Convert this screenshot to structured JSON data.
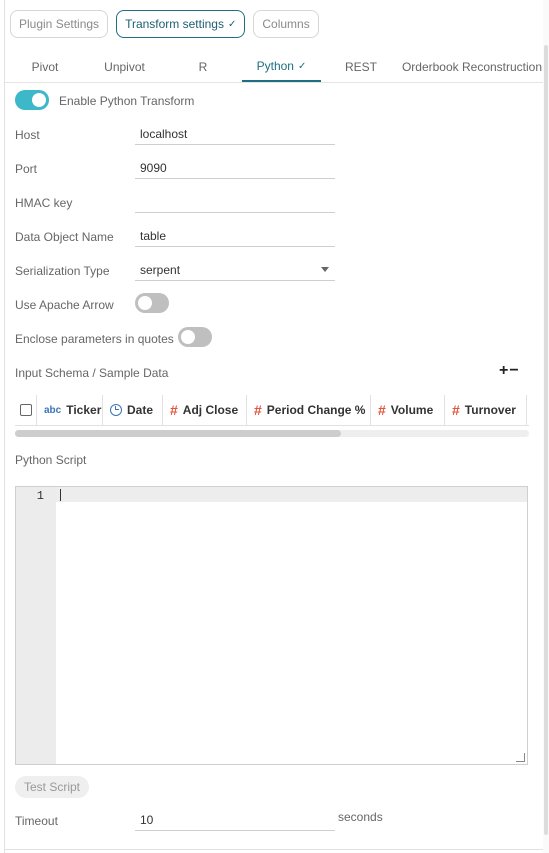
{
  "top_buttons": {
    "plugin_settings": "Plugin Settings",
    "transform_settings": "Transform settings",
    "columns": "Columns"
  },
  "check_glyph": "✓",
  "tabs": [
    "Pivot",
    "Unpivot",
    "R",
    "Python",
    "REST",
    "Orderbook Reconstruction"
  ],
  "active_tab": "Python",
  "enable_python": {
    "label": "Enable Python Transform",
    "on": true
  },
  "fields": {
    "host": {
      "label": "Host",
      "value": "localhost"
    },
    "port": {
      "label": "Port",
      "value": "9090"
    },
    "hmac": {
      "label": "HMAC key",
      "value": ""
    },
    "data_object": {
      "label": "Data Object Name",
      "value": "table"
    },
    "serialization": {
      "label": "Serialization Type",
      "value": "serpent"
    }
  },
  "use_apache_arrow": {
    "label": "Use Apache Arrow",
    "on": false
  },
  "enclose_params": {
    "label": "Enclose parameters in quotes",
    "on": false
  },
  "input_schema": {
    "label": "Input Schema / Sample Data",
    "add": "+",
    "remove": "−",
    "columns": [
      {
        "name": "Ticker",
        "icon": "abc"
      },
      {
        "name": "Date",
        "icon": "clock"
      },
      {
        "name": "Adj Close",
        "icon": "#"
      },
      {
        "name": "Period Change %",
        "icon": "#"
      },
      {
        "name": "Volume",
        "icon": "#"
      },
      {
        "name": "Turnover",
        "icon": "#"
      }
    ]
  },
  "python_script": {
    "label": "Python Script",
    "line_number": "1"
  },
  "test_script": "Test Script",
  "timeout": {
    "label": "Timeout",
    "value": "10",
    "unit": "seconds"
  },
  "colors": {
    "accent": "#1e6f82",
    "toggle_on": "#3cb8c9",
    "number_icon": "#e2553c",
    "text_icon": "#3a73b8"
  }
}
